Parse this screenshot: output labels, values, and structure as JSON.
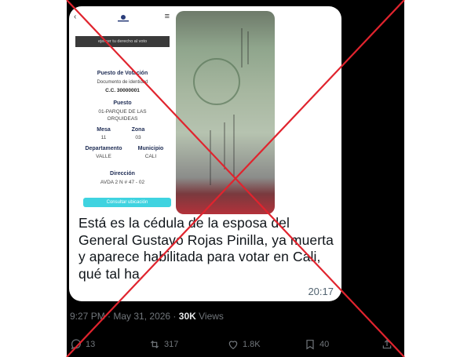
{
  "phone": {
    "banner": "ejercer tu derecho al voto",
    "puesto_votacion_label": "Puesto de Votación",
    "documento_label": "Documento de identidad",
    "documento_value": "C.C. 30000001",
    "puesto_label": "Puesto",
    "puesto_value_1": "01-PARQUE DE LAS",
    "puesto_value_2": "ORQUIDEAS",
    "mesa_label": "Mesa",
    "mesa_value": "11",
    "zona_label": "Zona",
    "zona_value": "03",
    "departamento_label": "Departamento",
    "departamento_value": "VALLE",
    "municipio_label": "Municipio",
    "municipio_value": "CALI",
    "direccion_label": "Dirección",
    "direccion_value": "AVDA 2 N # 47 - 02",
    "button": "Consultar ubicación"
  },
  "tweet": {
    "text": "Está es la cédula de la esposa del General Gustavo Rojas Pinilla, ya muerta y aparece habilitada para votar en Cali, qué tal ha.",
    "video_time": "20:17",
    "time": "9:27 PM",
    "date": "May 31, 2026",
    "views_count": "30K",
    "views_label": "Views"
  },
  "actions": {
    "replies": "13",
    "reposts": "317",
    "likes": "1.8K",
    "bookmarks": "40"
  },
  "colors": {
    "x_mark": "#e0242e",
    "accent_cyan": "#3fd3e0"
  }
}
